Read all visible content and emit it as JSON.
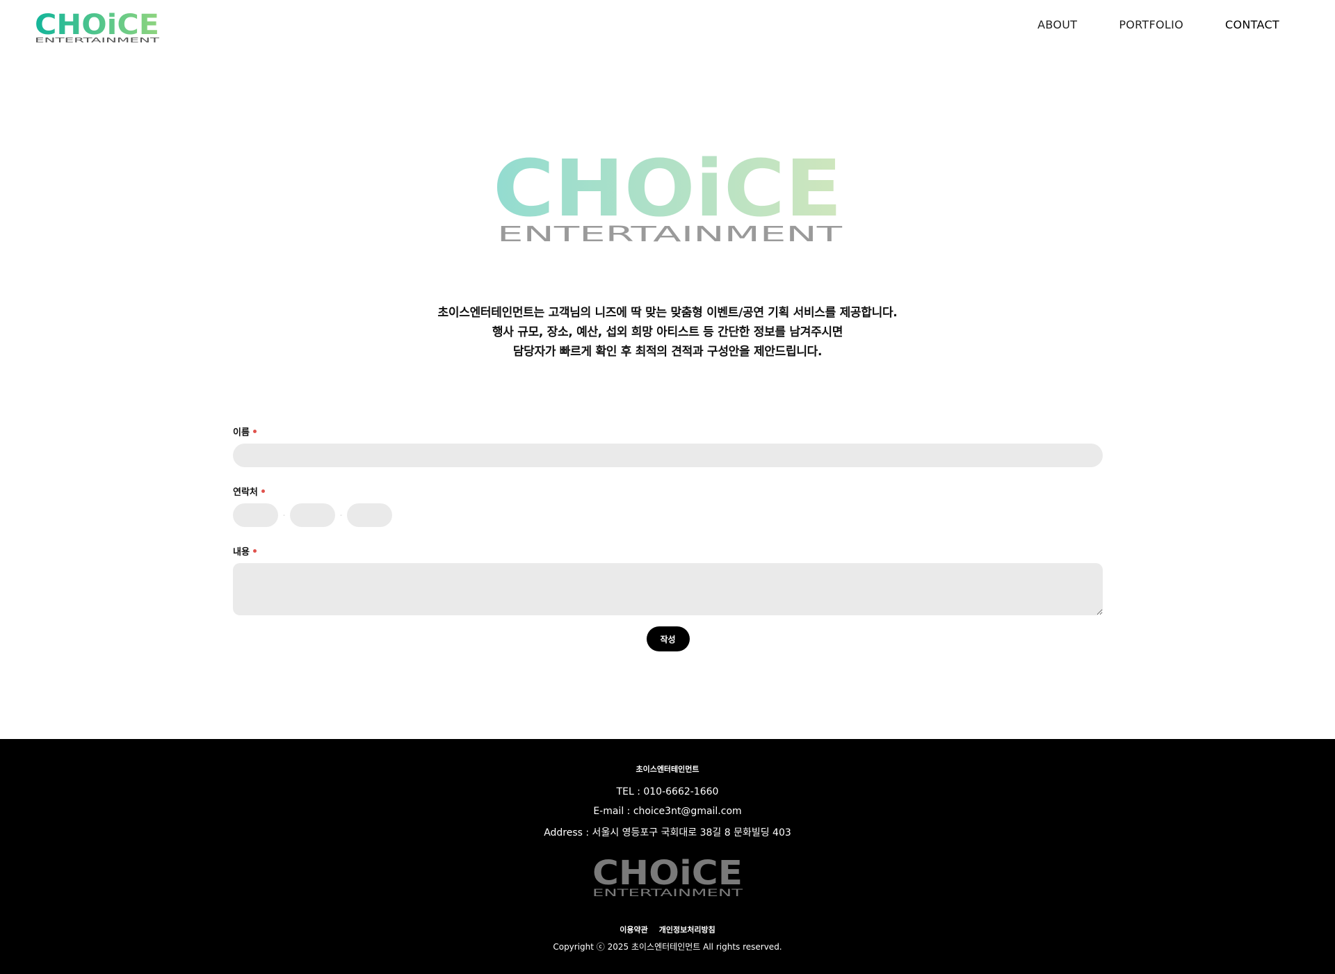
{
  "header": {
    "logo": {
      "text": "CHOiCE",
      "subtext": "ENTERTAINMENT"
    },
    "nav": [
      {
        "label": "ABOUT"
      },
      {
        "label": "PORTFOLIO"
      },
      {
        "label": "CONTACT",
        "active": true
      }
    ]
  },
  "hero": {
    "logo": {
      "text": "CHOiCE",
      "subtext": "ENTERTAINMENT"
    },
    "intro": [
      "초이스엔터테인먼트는 고객님의 니즈에 딱 맞는 맞춤형 이벤트/공연 기획 서비스를 제공합니다.",
      "행사 규모, 장소, 예산, 섭외 희망 아티스트 등 간단한 정보를 남겨주시면",
      "담당자가 빠르게 확인 후 최적의 견적과 구성안을 제안드립니다."
    ]
  },
  "form": {
    "name_label": "이름",
    "name_value": "",
    "phone_label": "연락처",
    "phone_values": [
      "",
      "",
      ""
    ],
    "phone_separator": "-",
    "content_label": "내용",
    "content_value": "",
    "submit_label": "작성"
  },
  "footer": {
    "company": "초이스엔터테인먼트",
    "tel": "TEL : 010-6662-1660",
    "email": "E-mail : choice3nt@gmail.com",
    "address": "Address : 서울시 영등포구 국회대로 38길 8 문화빌딩 403",
    "logo": {
      "text": "CHOiCE",
      "subtext": "ENTERTAINMENT"
    },
    "links": [
      {
        "label": "이용약관"
      },
      {
        "label": "개인정보처리방침"
      }
    ],
    "copyright": "Copyright ⓒ 2025 초이스엔터테인먼트 All rights reserved."
  },
  "colors": {
    "logo_small_gradient": [
      "#13b59a",
      "#8fd47e"
    ],
    "logo_hero_gradient": [
      "#93dcd0",
      "#cfe6bd"
    ],
    "logo_footer": "#7a7a7a",
    "required_dot": "#e0524d",
    "input_bg": "#eaeaea",
    "footer_bg": "#000000"
  }
}
